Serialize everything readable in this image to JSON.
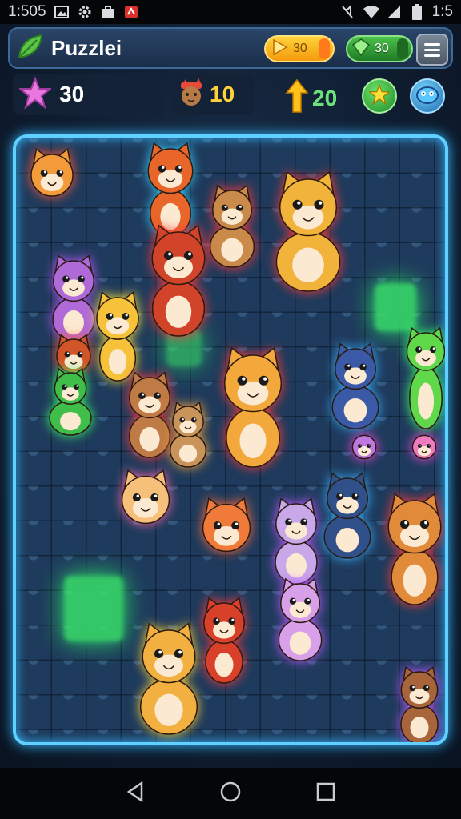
{
  "status_bar": {
    "time": "1:505",
    "clock_right": "1:5",
    "left_icons": [
      "image-icon",
      "gear-icon",
      "briefcase-icon",
      "app-icon"
    ],
    "right_icons": [
      "mute-icon",
      "wifi-icon",
      "signal-icon",
      "battery-icon"
    ]
  },
  "header": {
    "title": "Puzzlei",
    "logo_icon": "leaf-icon",
    "energy": {
      "value": "30",
      "icon": "play-icon",
      "color": "#f7a21b"
    },
    "gems": {
      "value": "30",
      "icon": "gem-icon",
      "color": "#2f9a35"
    },
    "menu_icon": "hamburger-icon"
  },
  "stats": {
    "stars": "30",
    "characters": "10",
    "moves": "20",
    "star_icon": "star-icon",
    "character_icon": "cat-head-icon",
    "moves_icon": "up-arrow-icon",
    "hint_icon": "star-badge-icon",
    "extra_icon": "blob-icon"
  },
  "board": {
    "border_color": "#5fd0ff",
    "pieces": [
      {
        "name": "orange-cat-head",
        "color": "#f39a3a",
        "glow": "#ff5a3a"
      },
      {
        "name": "fox-standing",
        "color": "#e8662a",
        "glow": "#3ad0ff"
      },
      {
        "name": "brown-cat-sitting",
        "color": "#c98a4a",
        "glow": "#ff3a3a"
      },
      {
        "name": "ginger-cat-big",
        "color": "#f2b33a",
        "glow": "#ff3a3a"
      },
      {
        "name": "lion-standing",
        "color": "#d2442a",
        "glow": "#ff3a3a"
      },
      {
        "name": "purple-hair-kid",
        "color": "#b06ad8",
        "glow": "#c05aff"
      },
      {
        "name": "yellow-duck-kid",
        "color": "#f5c23a",
        "glow": "#ffe03a"
      },
      {
        "name": "fox-small",
        "color": "#d2552a",
        "glow": "#ff5a2a"
      },
      {
        "name": "green-hair-kid",
        "color": "#3fbf4a",
        "glow": "#3aff6a"
      },
      {
        "name": "brown-bear-cub",
        "color": "#c07a45",
        "glow": "#ff3a3a"
      },
      {
        "name": "tan-cat-small",
        "color": "#c9945a",
        "glow": "#ffaa3a"
      },
      {
        "name": "orange-cat-sword",
        "color": "#f2a83a",
        "glow": "#ff3a3a"
      },
      {
        "name": "blue-cat",
        "color": "#3a5aa8",
        "glow": "#3ab0ff"
      },
      {
        "name": "green-alien",
        "color": "#5fd84a",
        "glow": "#3aff6a"
      },
      {
        "name": "pink-ball",
        "color": "#c078e0",
        "glow": "#ff4ae0"
      },
      {
        "name": "pink-ball-2",
        "color": "#f07ac0",
        "glow": "#ff4ae0"
      },
      {
        "name": "cream-cat-head",
        "color": "#f7c07a",
        "glow": "#ff6aaa"
      },
      {
        "name": "orange-fox-head",
        "color": "#f07a3a",
        "glow": "#ff6a3a"
      },
      {
        "name": "lilac-cat",
        "color": "#c8a8e8",
        "glow": "#c05aff"
      },
      {
        "name": "navy-cat",
        "color": "#30508a",
        "glow": "#3ab0ff"
      },
      {
        "name": "lion-cub",
        "color": "#e08a3a",
        "glow": "#ff3a3a"
      },
      {
        "name": "red-fox",
        "color": "#d8402a",
        "glow": "#ff3a3a"
      },
      {
        "name": "pink-kitten",
        "color": "#d8a0e8",
        "glow": "#c05aff"
      },
      {
        "name": "yellow-cat-standing",
        "color": "#f2b040",
        "glow": "#ffd23a"
      },
      {
        "name": "brown-bear-hat",
        "color": "#a8643a",
        "glow": "#c05aff"
      }
    ]
  },
  "nav": {
    "back_icon": "back-triangle-icon",
    "home_icon": "home-circle-icon",
    "recents_icon": "recents-square-icon"
  }
}
